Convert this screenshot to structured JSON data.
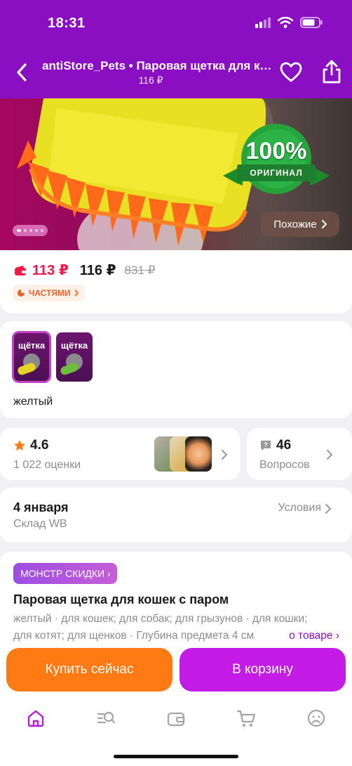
{
  "status_bar": {
    "time": "18:31"
  },
  "nav": {
    "title": "antiStore_Pets • Паровая щетка для кошек с паром",
    "price": "116 ₽"
  },
  "gallery": {
    "badge_percent": "100%",
    "badge_text": "ОРИГИНАЛ",
    "similar_label": "Похожие",
    "slide_count": 5,
    "active_slide": 1
  },
  "price": {
    "wallet_price": "113 ₽",
    "price": "116 ₽",
    "old_price": "831 ₽",
    "installments_label": "ЧАСТЯМИ"
  },
  "color": {
    "swatch_text": "щётка",
    "selected": "желтый"
  },
  "rating": {
    "value": "4.6",
    "count_label": "1 022 оценки"
  },
  "questions": {
    "count": "46",
    "label": "Вопросов"
  },
  "delivery": {
    "date": "4 января",
    "warehouse": "Склад WB",
    "conditions_label": "Условия"
  },
  "description": {
    "badge": "МОНСТР СКИДКИ",
    "title": "Паровая щетка для кошек с паром",
    "text": "желтый · для кошек; для собак; для грызунов · для кошки; для котят; для щенков · Глубина предмета 4 см",
    "more_label": "о товаре"
  },
  "actions": {
    "buy_now": "Купить сейчас",
    "add_to_cart": "В корзину"
  },
  "colors": {
    "brand": "#8a0ec2",
    "buy": "#ff7a12",
    "cart": "#c21ce6",
    "sale": "#f5164a",
    "installments": "#e8632a"
  },
  "tabs": [
    "home-icon",
    "catalog-search-icon",
    "wallet-icon",
    "cart-icon",
    "profile-icon"
  ]
}
